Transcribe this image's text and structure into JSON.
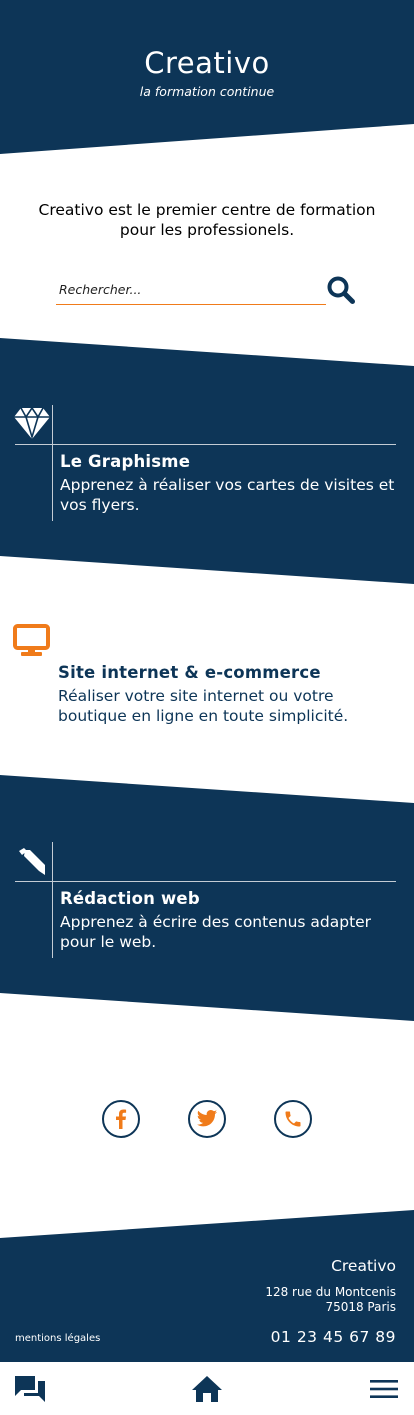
{
  "header": {
    "title": "Creativo",
    "subtitle": "la formation continue"
  },
  "intro": {
    "text": "Creativo est le premier centre de formation pour les professionels."
  },
  "search": {
    "placeholder": "Rechercher...",
    "value": "",
    "button_icon": "search-icon"
  },
  "services": [
    {
      "icon": "diamond-icon",
      "title": "Le Graphisme",
      "description": "Apprenez à réaliser vos cartes de visites et vos flyers."
    },
    {
      "icon": "desktop-icon",
      "title": "Site internet & e-commerce",
      "description": "Réaliser votre site internet ou votre boutique en ligne en toute simplicité."
    },
    {
      "icon": "pencil-icon",
      "title": "Rédaction web",
      "description": "Apprenez à écrire des contenus adapter pour le web."
    }
  ],
  "social": [
    {
      "icon": "facebook-icon"
    },
    {
      "icon": "twitter-icon"
    },
    {
      "icon": "phone-icon"
    }
  ],
  "footer": {
    "name": "Creativo",
    "address_line1": "128 rue du Montcenis",
    "address_line2": "75018 Paris",
    "legal_link": "mentions légales",
    "phone": "01 23 45 67 89"
  },
  "bottom_nav": [
    {
      "icon": "chat-icon"
    },
    {
      "icon": "home-icon"
    },
    {
      "icon": "menu-icon"
    }
  ],
  "colors": {
    "navy": "#0d3557",
    "accent": "#f07b1a",
    "white": "#ffffff"
  }
}
